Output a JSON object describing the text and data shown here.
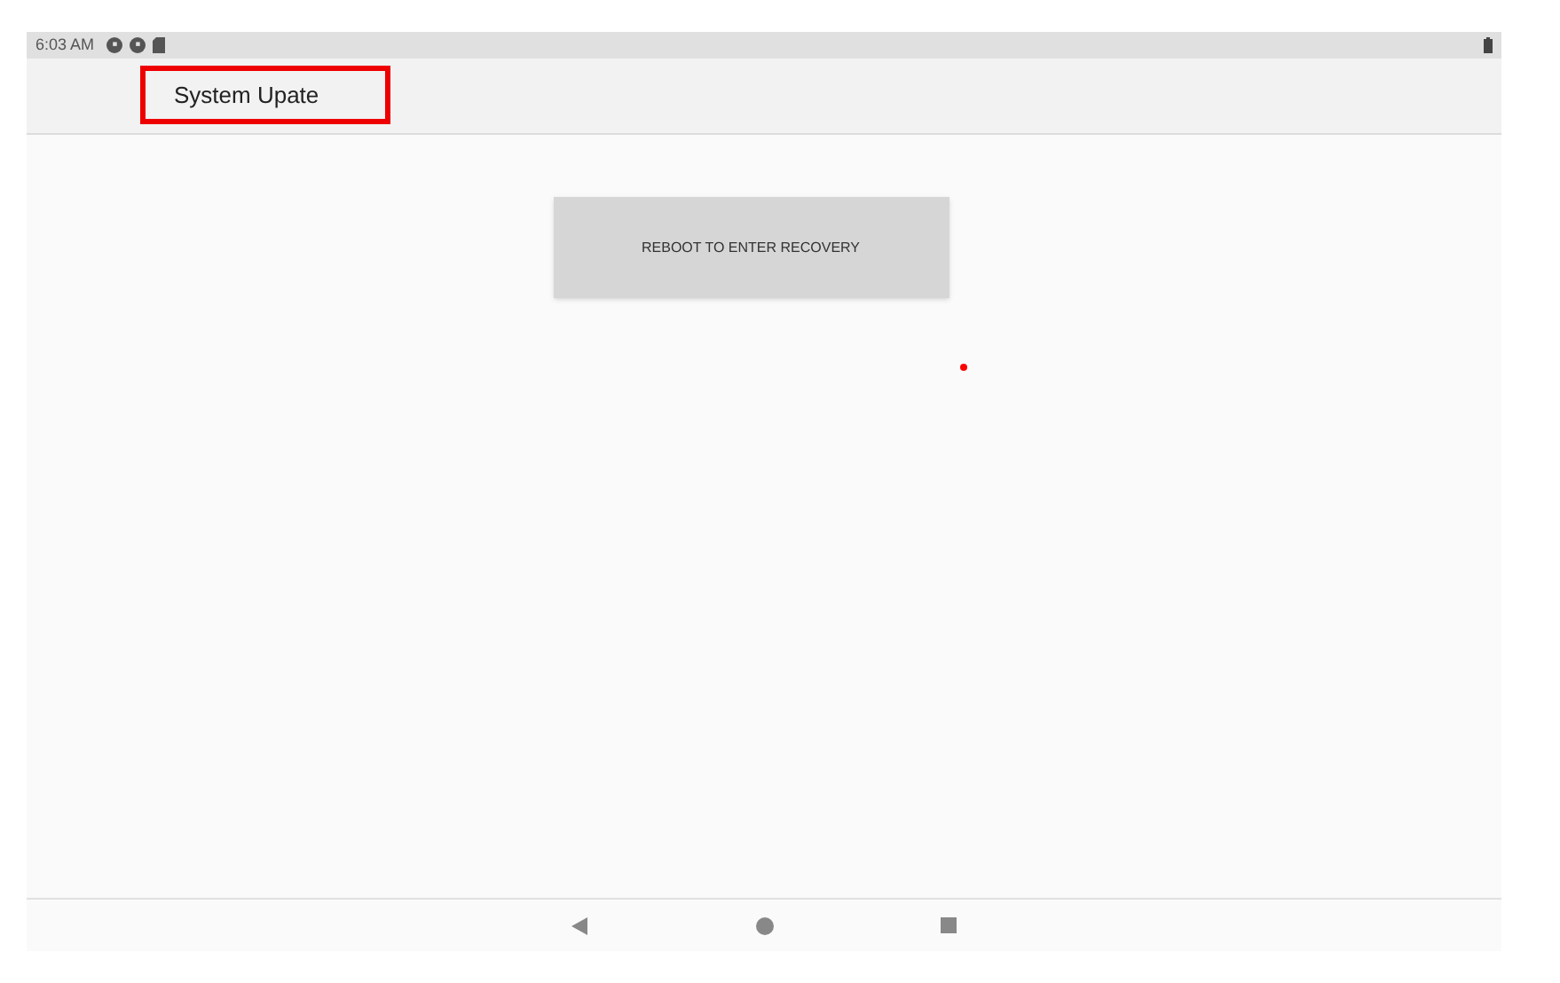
{
  "status_bar": {
    "time": "6:03 AM"
  },
  "app_bar": {
    "title": "System Upate",
    "highlighted": true
  },
  "content": {
    "button": "REBOOT TO ENTER RECOVERY"
  }
}
